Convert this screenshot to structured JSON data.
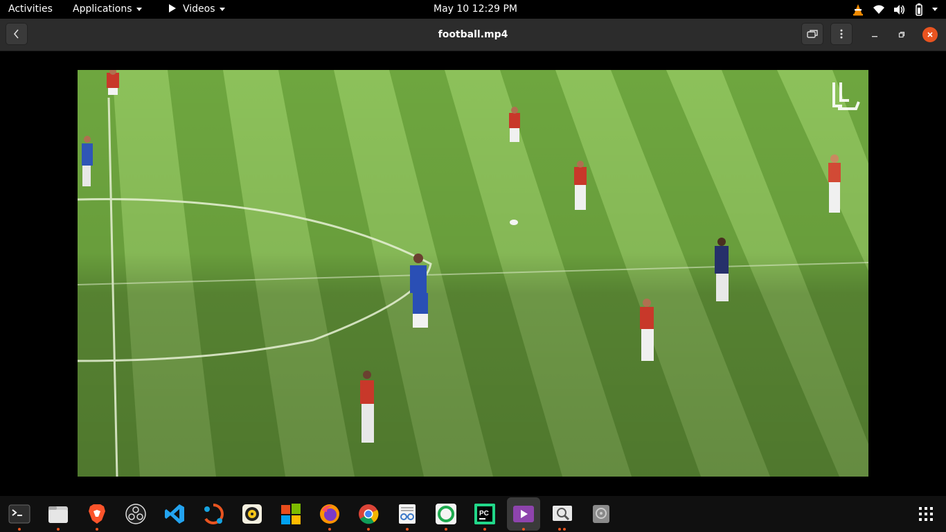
{
  "topbar": {
    "activities": "Activities",
    "applications": "Applications",
    "videos": "Videos",
    "clock": "May 10  12:29 PM"
  },
  "window": {
    "title": "football.mp4"
  },
  "video": {
    "watermark_icon": "ll-logo-watermark"
  },
  "dock": {
    "apps": [
      {
        "name": "terminal",
        "icon": "terminal-icon",
        "running": true
      },
      {
        "name": "files",
        "icon": "files-icon",
        "running": true
      },
      {
        "name": "brave",
        "icon": "brave-icon",
        "running": true
      },
      {
        "name": "obs",
        "icon": "obs-icon",
        "running": false
      },
      {
        "name": "vscode",
        "icon": "vscode-icon",
        "running": false
      },
      {
        "name": "network",
        "icon": "network-icon",
        "running": false
      },
      {
        "name": "rhythmbox",
        "icon": "rhythmbox-icon",
        "running": false
      },
      {
        "name": "windows",
        "icon": "windows-icon",
        "running": false
      },
      {
        "name": "firefox",
        "icon": "firefox-icon",
        "running": true
      },
      {
        "name": "chrome",
        "icon": "chrome-icon",
        "running": true
      },
      {
        "name": "reader",
        "icon": "reader-icon",
        "running": true
      },
      {
        "name": "qgis",
        "icon": "green-ring-icon",
        "running": true
      },
      {
        "name": "pycharm",
        "icon": "pycharm-icon",
        "running": true
      },
      {
        "name": "videos",
        "icon": "videos-icon",
        "running": true
      },
      {
        "name": "image-viewer",
        "icon": "image-viewer-icon",
        "running": true
      },
      {
        "name": "disk",
        "icon": "disk-icon",
        "running": false
      }
    ]
  },
  "colors": {
    "accent": "#e95420",
    "pitch_light": "#8fc25a",
    "pitch_dark": "#5f9a35"
  }
}
